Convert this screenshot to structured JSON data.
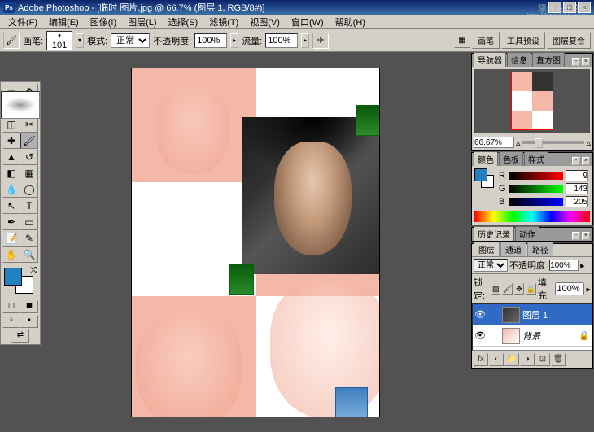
{
  "title": "Adobe Photoshop - [临时 图片.jpg @ 66.7% (图层 1, RGB/8#)]",
  "watermark1": "思缘设计论坛",
  "watermark2": "bbs.Missyuan.com",
  "menu": {
    "file": "文件(F)",
    "edit": "编辑(E)",
    "image": "图像(I)",
    "layer": "图层(L)",
    "select": "选择(S)",
    "filter": "滤镜(T)",
    "view": "视图(V)",
    "window": "窗口(W)",
    "help": "帮助(H)"
  },
  "optbar": {
    "brush_lbl": "画笔:",
    "brush_size": "101",
    "mode_lbl": "模式:",
    "mode_val": "正常",
    "opacity_lbl": "不透明度:",
    "opacity_val": "100%",
    "flow_lbl": "流量:",
    "flow_val": "100%",
    "rt_brush": "画笔",
    "rt_preset": "工具预设",
    "rt_comp": "图层复合"
  },
  "nav": {
    "tab1": "导航器",
    "tab2": "信息",
    "tab3": "直方图",
    "zoom": "66.67%"
  },
  "color": {
    "tab1": "颜色",
    "tab2": "色板",
    "tab3": "样式",
    "r": "9",
    "g": "143",
    "b": "205",
    "r_lbl": "R",
    "g_lbl": "G",
    "b_lbl": "B"
  },
  "history": {
    "tab1": "历史记录",
    "tab2": "动作"
  },
  "layers": {
    "tab1": "图层",
    "tab2": "通道",
    "tab3": "路径",
    "blend": "正常",
    "opacity_lbl": "不透明度:",
    "opacity": "100%",
    "lock_lbl": "锁定:",
    "fill_lbl": "填充:",
    "fill": "100%",
    "layer1": "图层 1",
    "bg": "背景"
  }
}
